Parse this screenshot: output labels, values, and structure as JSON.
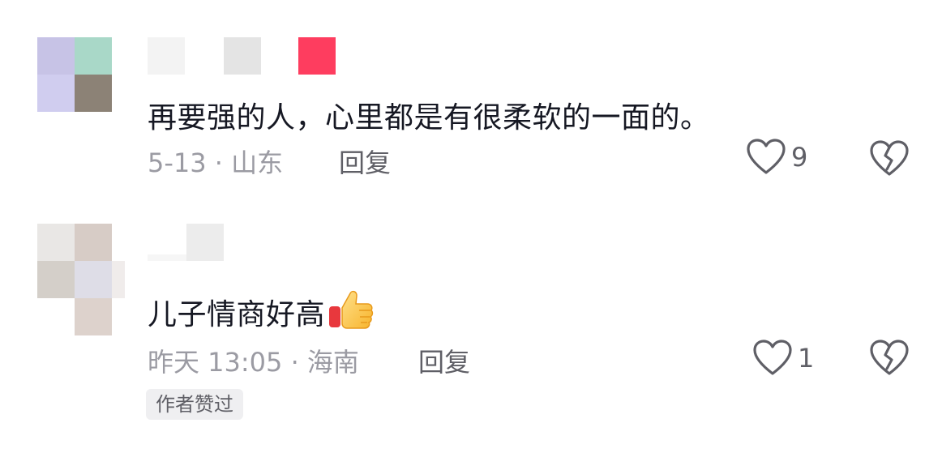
{
  "comments": [
    {
      "text": "再要强的人，心里都是有很柔软的一面的。",
      "meta": "5-13 · 山东",
      "reply_label": "回复",
      "like_count": "9",
      "author_liked_badge": ""
    },
    {
      "text": "儿子情商好高",
      "meta": "昨天 13:05 · 海南",
      "reply_label": "回复",
      "like_count": "1",
      "author_liked_badge": "作者赞过"
    }
  ],
  "icons": {
    "like": "heart-outline-icon",
    "dislike": "broken-heart-icon",
    "thumbs_up_emoji": "thumbs-up-emoji"
  },
  "colors": {
    "text_primary": "#161823",
    "text_secondary": "#9b9ba3",
    "icon": "#5f5f66",
    "badge_bg": "#efeff1",
    "name_accent": "#fe3d5f"
  }
}
